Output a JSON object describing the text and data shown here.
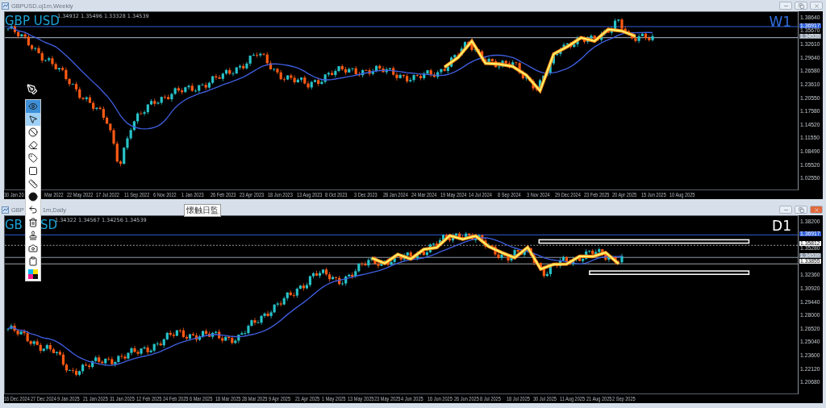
{
  "windows": [
    {
      "title": "GBPUSD.oj1m,Weekly",
      "quotes": "1.34932 1.35496 1.33328 1.34539",
      "symbol_label": [
        "GBP USD"
      ],
      "timeframe": "W1",
      "controls": [
        {
          "kind": "minimize",
          "highlighted": false
        },
        {
          "kind": "maximize",
          "highlighted": false
        },
        {
          "kind": "close",
          "highlighted": false
        }
      ],
      "price_ticks": [
        "1.38640",
        "1.35670",
        "1.32610",
        "1.29640",
        "1.26580",
        "1.23610",
        "1.20550",
        "1.17580",
        "1.14520",
        "1.11550",
        "1.08490",
        "1.05520",
        "1.02550"
      ],
      "price_markers": [
        {
          "value": "1.36917",
          "color": "#2f5fd8"
        },
        {
          "value": "1.34539",
          "color": "#8c97a6"
        }
      ],
      "dates": [
        "30 Jan 20",
        "Mar 2022",
        "22 May 2022",
        "17 Jul 2022",
        "11 Sep 2022",
        "6 Nov 2022",
        "1 Jan 2023",
        "26 Feb 2023",
        "23 Apr 2023",
        "18 Jun 2023",
        "13 Aug 2023",
        "8 Oct 2023",
        "3 Dec 2023",
        "28 Jan 2024",
        "24 Mar 2024",
        "19 May 2024",
        "14 Jul 2024",
        "8 Sep 2024",
        "3 Nov 2024",
        "29 Dec 2024",
        "23 Feb 2025",
        "20 Apr 2025",
        "15 Jun 2025",
        "10 Aug 2025"
      ]
    },
    {
      "title": "GBP",
      "title_hidden_part": "1m,Daily",
      "quotes": "1.34322 1.34567 1.34256 1.34539",
      "symbol_label": [
        "GB",
        "SD"
      ],
      "timeframe": "D1",
      "controls": [
        {
          "kind": "minimize",
          "highlighted": false
        },
        {
          "kind": "maximize",
          "highlighted": false
        },
        {
          "kind": "close",
          "highlighted": true
        }
      ],
      "price_ticks": [
        "1.38200",
        "1.35280",
        "1.32360",
        "1.30920",
        "1.29440",
        "1.28000",
        "1.26520",
        "1.25040",
        "1.23600",
        "1.22120",
        "1.20680"
      ],
      "price_markers": [
        {
          "value": "1.36917",
          "color": "#2f5fd8"
        },
        {
          "value": "1.35812",
          "color": "#ffffff"
        },
        {
          "value": "1.34539",
          "color": "#8c97a6"
        },
        {
          "value": "1.33855",
          "color": "#ffffff"
        }
      ],
      "dates": [
        "16 Dec 2024",
        "27 Dec 2024",
        "9 Jan 2025",
        "21 Jan 2025",
        "31 Jan 2025",
        "12 Feb 2025",
        "24 Feb 2025",
        "6 Mar 2025",
        "18 Mar 2025",
        "28 Mar 2025",
        "9 Apr 2025",
        "21 Apr 2025",
        "1 May 2025",
        "13 May 2025",
        "23 May 2025",
        "4 Jun 2025",
        "16 Jun 2025",
        "26 Jun 2025",
        "8 Jul 2025",
        "18 Jul 2025",
        "30 Jul 2025",
        "11 Aug 2025",
        "21 Aug 2025",
        "2 Sep 2025"
      ]
    }
  ],
  "toolbar": {
    "tools": [
      {
        "kind": "eye",
        "selected": true
      },
      {
        "kind": "pointer",
        "selected": true
      },
      {
        "kind": "ban",
        "selected": false
      },
      {
        "kind": "eraser",
        "selected": false
      },
      {
        "kind": "tag",
        "selected": false
      },
      {
        "kind": "square",
        "selected": false
      },
      {
        "kind": "ruler",
        "selected": false
      },
      {
        "kind": "dot",
        "selected": false
      },
      {
        "kind": "undo",
        "selected": false
      },
      {
        "kind": "trash",
        "selected": false
      },
      {
        "kind": "stamp",
        "selected": false
      },
      {
        "kind": "camera",
        "selected": false
      },
      {
        "kind": "clipboard",
        "selected": false
      },
      {
        "kind": "palette",
        "selected": false
      }
    ]
  },
  "tooltip": "懐触日監"
}
